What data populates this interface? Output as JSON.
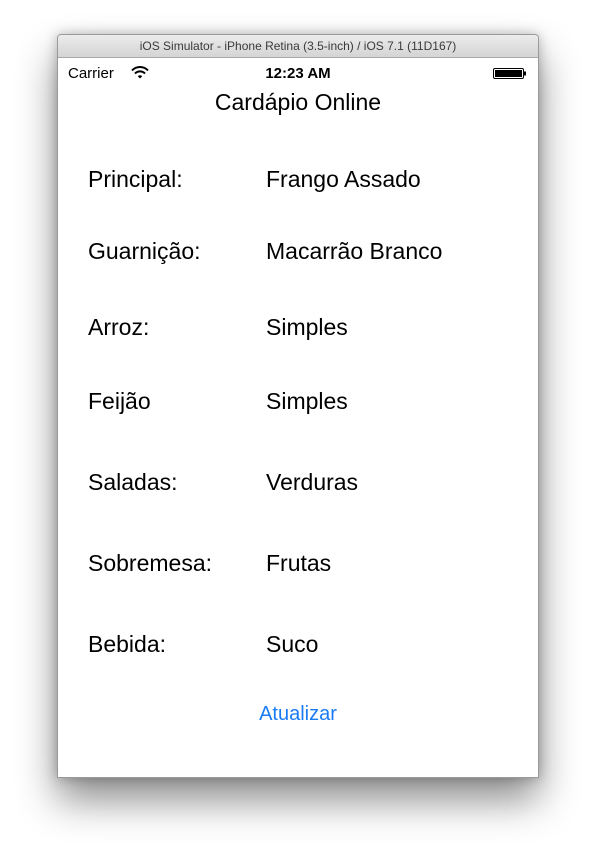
{
  "window": {
    "title": "iOS Simulator - iPhone Retina (3.5-inch) / iOS 7.1 (11D167)"
  },
  "status_bar": {
    "carrier": "Carrier",
    "time": "12:23 AM",
    "icons": [
      "wifi-icon",
      "battery-icon"
    ]
  },
  "nav": {
    "title": "Cardápio Online"
  },
  "menu": [
    {
      "label": "Principal:",
      "value": "Frango Assado"
    },
    {
      "label": "Guarnição:",
      "value": "Macarrão Branco"
    },
    {
      "label": "Arroz:",
      "value": "Simples"
    },
    {
      "label": "Feijão",
      "value": "Simples"
    },
    {
      "label": "Saladas:",
      "value": "Verduras"
    },
    {
      "label": "Sobremesa:",
      "value": "Frutas"
    },
    {
      "label": "Bebida:",
      "value": "Suco"
    }
  ],
  "actions": {
    "update_label": "Atualizar"
  },
  "colors": {
    "accent": "#1a7cf5"
  }
}
